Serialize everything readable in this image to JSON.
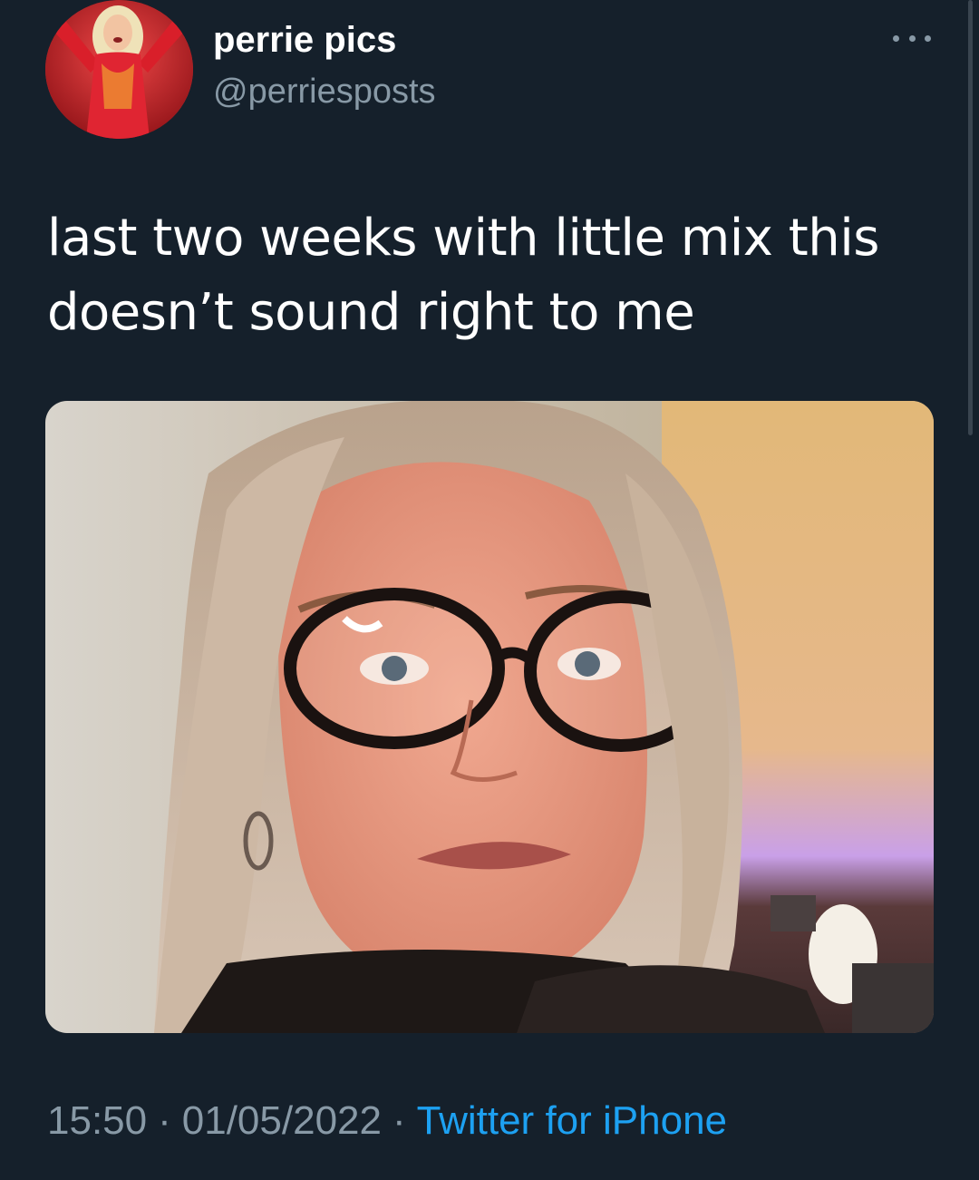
{
  "author": {
    "display_name": "perrie pics",
    "handle": "@perriesposts"
  },
  "tweet": {
    "text": "last two weeks with little mix this doesn’t sound right to me"
  },
  "meta": {
    "time": "15:50",
    "separator": "·",
    "date": "01/05/2022",
    "source": "Twitter for iPhone"
  },
  "icons": {
    "more": "more-options-icon"
  },
  "colors": {
    "background": "#15202b",
    "secondary_text": "#8899a6",
    "link": "#1da1f2"
  }
}
